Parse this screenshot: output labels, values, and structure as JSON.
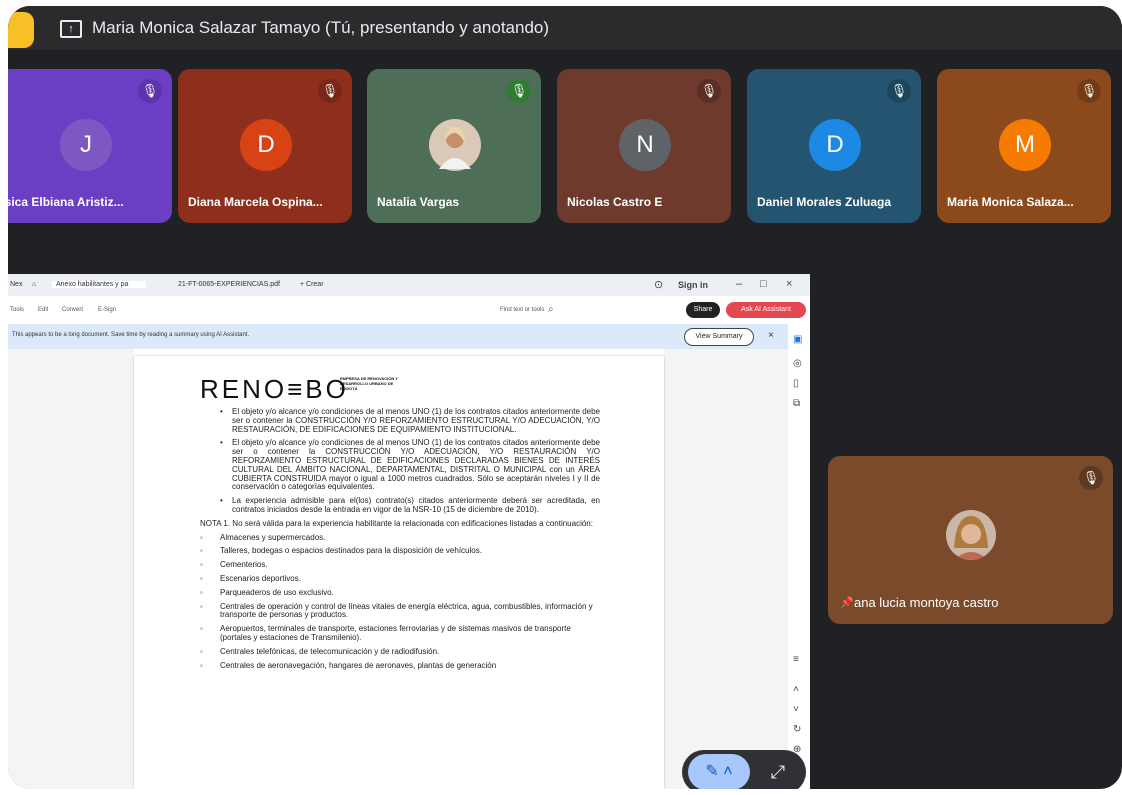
{
  "topbar": {
    "title": "Maria Monica Salazar Tamayo (Tú, presentando y anotando)"
  },
  "participants": [
    {
      "initial": "J",
      "name": "esica Elbiana Aristiz...",
      "color": "#6a3fc4",
      "avatar_color": "#7e57c2"
    },
    {
      "initial": "D",
      "name": "Diana Marcela Ospina...",
      "color": "#8e2f1e",
      "avatar_color": "#d84315"
    },
    {
      "initial": "",
      "name": "Natalia Vargas",
      "color": "#4e6e57",
      "avatar_color": "#d9c9b6"
    },
    {
      "initial": "N",
      "name": "Nicolas Castro E",
      "color": "#6e3a2d",
      "avatar_color": "#5f6368"
    },
    {
      "initial": "D",
      "name": "Daniel Morales Zuluaga",
      "color": "#24546f",
      "avatar_color": "#1e88e5"
    },
    {
      "initial": "M",
      "name": "Maria Monica Salaza...",
      "color": "#8c4a1c",
      "avatar_color": "#f57c00"
    }
  ],
  "pinned": {
    "name": "ana lucia montoya castro"
  },
  "browser": {
    "tabs": [
      "Nex",
      "Anexo habilitantes y pa",
      "21-FT-0065-EXPERIENCIAS.pdf",
      "+ Crear"
    ],
    "sign_in": "Sign in",
    "menu": [
      "Tools",
      "Edit",
      "Convert",
      "E-Sign"
    ],
    "find_text": "Find text or tools",
    "share": "Share",
    "ai_assistant": "Ask AI Assistant",
    "banner_text": "This appears to be a long document. Save time by reading a summary using AI Assistant.",
    "view_summary": "View Summary"
  },
  "document": {
    "logo": "RENO≡BO",
    "logo_sub": "EMPRESA DE RENOVACIÓN Y DESARROLLO URBANO DE BOGOTÁ",
    "bullet1": "El objeto y/o alcance y/o condiciones de al menos UNO (1) de los contratos citados anteriormente debe ser o contener la CONSTRUCCIÓN Y/O REFORZAMIENTO ESTRUCTURAL Y/O ADECUACIÓN, Y/O RESTAURACIÓN, DE EDIFICACIONES DE EQUIPAMIENTO INSTITUCIONAL.",
    "bullet2": "El objeto y/o alcance y/o condiciones de al menos UNO (1) de los contratos citados anteriormente debe ser o contener la CONSTRUCCIÓN Y/O ADECUACIÓN, Y/O RESTAURACIÓN Y/O REFORZAMIENTO ESTRUCTURAL DE EDIFICACIONES DECLARADAS BIENES DE INTERÉS CULTURAL DEL ÁMBITO NACIONAL, DEPARTAMENTAL, DISTRITAL O MUNICIPAL con un ÁREA CUBIERTA CONSTRUIDA mayor o igual a 1000 metros cuadrados. Sólo se aceptarán niveles I y II de conservación o categorías equivalentes.",
    "bullet3": "La experiencia admisible para el(los) contrato(s) citados anteriormente deberá ser acreditada, en contratos iniciados desde la entrada en vigor de la NSR-10 (15 de diciembre de 2010).",
    "note": "NOTA 1. No será válida para la experiencia habilitante la relacionada con edificaciones listadas a continuación:",
    "items": [
      "Almacenes y supermercados.",
      "Talleres, bodegas o espacios destinados para la disposición de vehículos.",
      "Cementerios.",
      "Escenarios deportivos.",
      "Parqueaderos de uso exclusivo.",
      "Centrales de operación y control de líneas vitales de energía eléctrica, agua, combustibles, información y transporte de personas y productos.",
      "Aeropuertos, terminales de transporte, estaciones ferroviarias y de sistemas masivos de transporte (portales y estaciones de Transmilenio).",
      "Centrales telefónicas, de telecomunicación y de radiodifusión.",
      "Centrales de aeronavegación, hangares de aeronaves, plantas de generación"
    ]
  },
  "colors": {
    "frame": "#202124",
    "topbar": "#2b2b2e",
    "pinned_tile": "#7a4a2a",
    "bubble_accent": "#a8c7fa"
  }
}
